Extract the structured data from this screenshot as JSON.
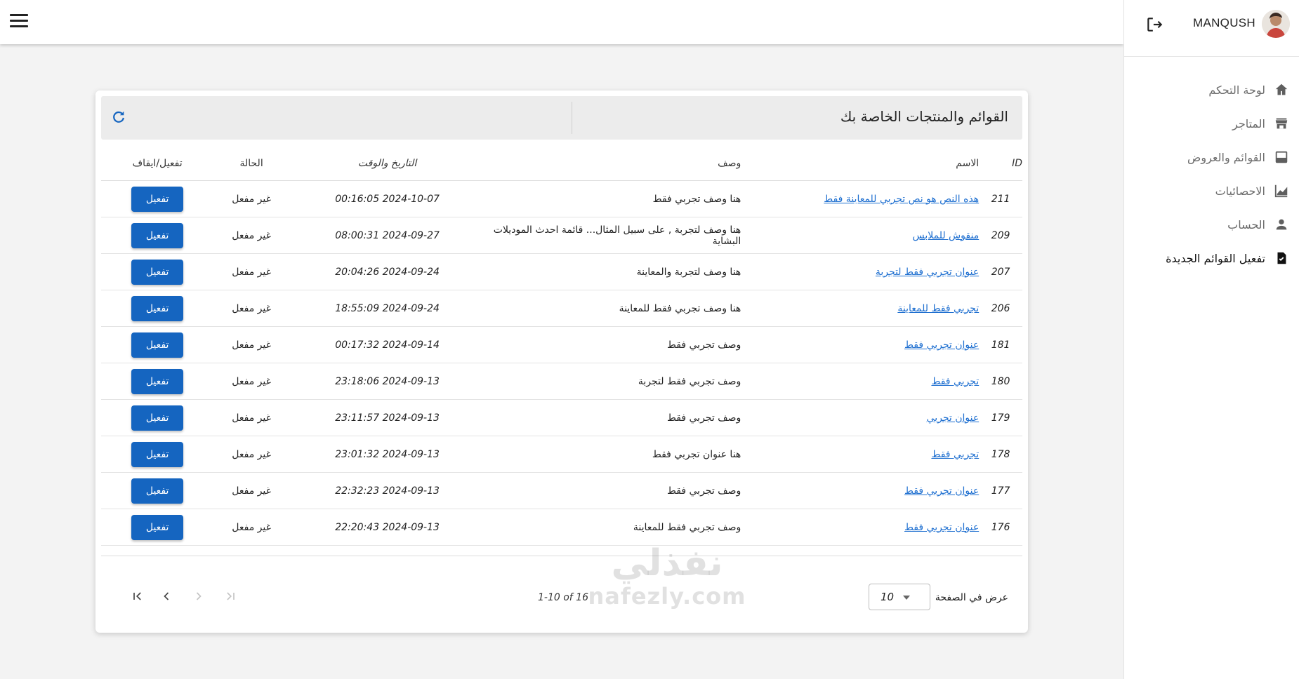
{
  "user": {
    "name": "MANQUSH"
  },
  "sidebar": {
    "items": [
      {
        "label": "لوحة التحكم",
        "icon": "home-icon",
        "active": false
      },
      {
        "label": "المتاجر",
        "icon": "store-icon",
        "active": false
      },
      {
        "label": "القوائم والعروض",
        "icon": "list-icon",
        "active": false
      },
      {
        "label": "الاحصائيات",
        "icon": "chart-icon",
        "active": false
      },
      {
        "label": "الحساب",
        "icon": "person-icon",
        "active": false
      },
      {
        "label": "تفعيل القوائم الجديدة",
        "icon": "activate-list-icon",
        "active": true
      }
    ]
  },
  "card": {
    "title": "القوائم والمنتجات الخاصة بك"
  },
  "table": {
    "headers": {
      "id": "ID",
      "name": "الاسم",
      "desc": "وصف",
      "date": "التاريخ والوقت",
      "status": "الحالة",
      "action": "تفعيل/ايقاف"
    },
    "rows": [
      {
        "id": "211",
        "name": "هذه النص هو نص تجربي للمعاينة فقط",
        "desc": "هنا وصف تجربي فقط",
        "date": "2024-10-07 00:16:05",
        "status": "غير مفعل",
        "action": "تفعيل"
      },
      {
        "id": "209",
        "name": "منقوش للملابس",
        "desc": "هنا وصف لتجربة , على سبيل المثال... قائمة احدث الموديلات البشاية",
        "date": "2024-09-27 08:00:31",
        "status": "غير مفعل",
        "action": "تفعيل"
      },
      {
        "id": "207",
        "name": "عنوان تجربي فقط لتجربة",
        "desc": "هنا وصف لتجربة والمعاينة",
        "date": "2024-09-24 20:04:26",
        "status": "غير مفعل",
        "action": "تفعيل"
      },
      {
        "id": "206",
        "name": "تجربي فقط للمعاينة",
        "desc": "هنا وصف تجربي فقط للمعاينة",
        "date": "2024-09-24 18:55:09",
        "status": "غير مفعل",
        "action": "تفعيل"
      },
      {
        "id": "181",
        "name": "عنوان تجربي فقط",
        "desc": "وصف تجربي فقط",
        "date": "2024-09-14 00:17:32",
        "status": "غير مفعل",
        "action": "تفعيل"
      },
      {
        "id": "180",
        "name": "تجربي فقط",
        "desc": "وصف تجربي فقط لتجربة",
        "date": "2024-09-13 23:18:06",
        "status": "غير مفعل",
        "action": "تفعيل"
      },
      {
        "id": "179",
        "name": "عنوان تجربي",
        "desc": "وصف تجربي فقط",
        "date": "2024-09-13 23:11:57",
        "status": "غير مفعل",
        "action": "تفعيل"
      },
      {
        "id": "178",
        "name": "تجربي فقط",
        "desc": "هنا عنوان تجربي فقط",
        "date": "2024-09-13 23:01:32",
        "status": "غير مفعل",
        "action": "تفعيل"
      },
      {
        "id": "177",
        "name": "عنوان تجربي فقط",
        "desc": "وصف تجربي فقط",
        "date": "2024-09-13 22:32:23",
        "status": "غير مفعل",
        "action": "تفعيل"
      },
      {
        "id": "176",
        "name": "عنوان تجربي فقط",
        "desc": "وصف تجربي فقط للمعاينة",
        "date": "2024-09-13 22:20:43",
        "status": "غير مفعل",
        "action": "تفعيل"
      }
    ]
  },
  "pagination": {
    "per_page_label": "عرض في الصفحة",
    "per_page_value": "10",
    "range": "1-10 of 16"
  },
  "watermark": {
    "arabic": "نفذلي",
    "latin": "nafezly.com"
  },
  "colors": {
    "primary": "#1565c0",
    "link": "#1e6fd0",
    "background": "#f3f3f3"
  }
}
